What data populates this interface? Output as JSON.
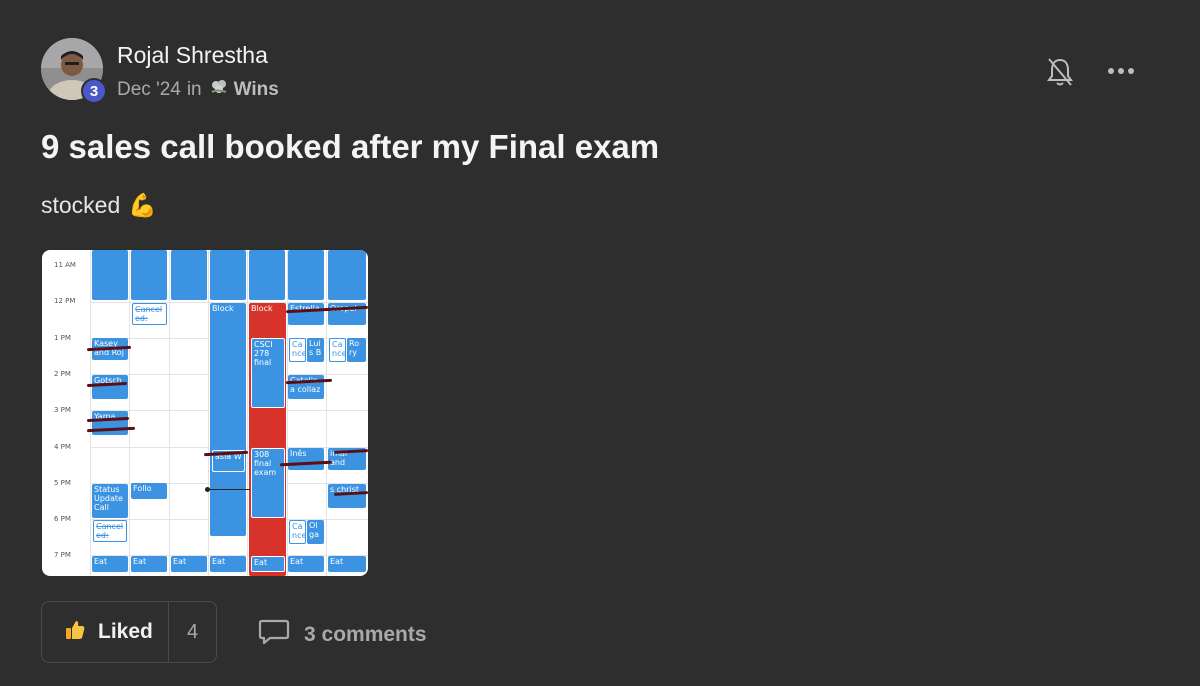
{
  "post": {
    "author": "Rojal Shrestha",
    "level": "3",
    "date": "Dec '24",
    "in_word": "in",
    "category": "Wins",
    "title": "9 sales call booked after my Final exam",
    "body": "stocked",
    "body_emoji": "💪"
  },
  "calendar_image": {
    "times": [
      "11 AM",
      "12 PM",
      "1 PM",
      "2 PM",
      "3 PM",
      "4 PM",
      "5 PM",
      "6 PM",
      "7 PM"
    ],
    "events": {
      "cancel1": "Cancel ed: Vict",
      "block1": "Block",
      "block2": "Block",
      "estrella": "Estrella",
      "oropel": "Oropel",
      "kasey": "Kasey and Roj",
      "csci278": "CSCI 278 final",
      "ca1": "Ca nce",
      "luis": "Lui s B",
      "ca2": "Ca nce",
      "ro": "Ro ry",
      "gotsch": "Gotsch",
      "catalina": "Catalin a collaz",
      "yama": "Yama",
      "asia": "asia W",
      "final308": "308 final exam",
      "ines": "Inês",
      "imal": "imal and",
      "status": "Status Update Call",
      "follow": "Follo",
      "christ": "s christ",
      "cancel2": "Cancel ed: ORI",
      "ca3": "Ca nce",
      "olga": "Ol ga",
      "eat": "Eat"
    }
  },
  "footer": {
    "like_label": "Liked",
    "like_count": "4",
    "comments_label": "3 comments"
  }
}
